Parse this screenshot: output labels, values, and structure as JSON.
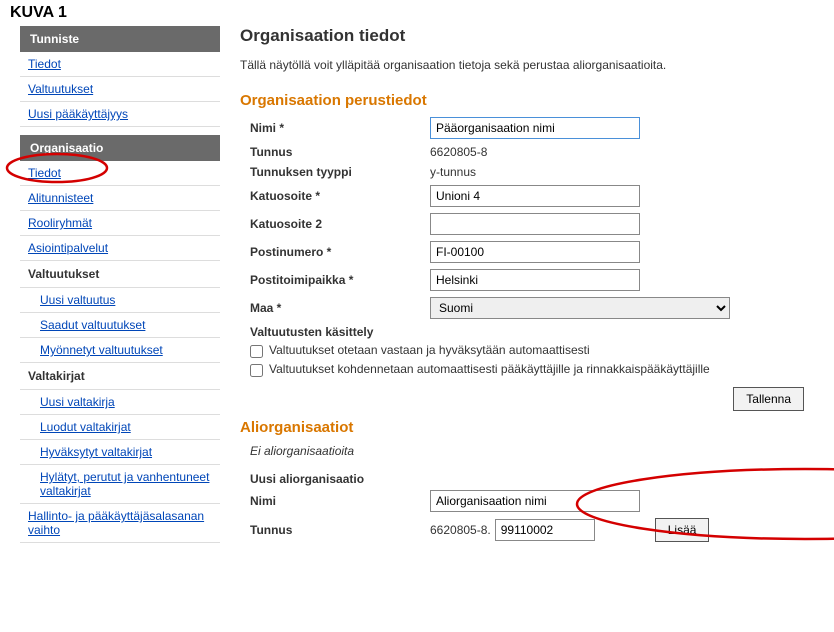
{
  "header_label": "KUVA 1",
  "sidebar": {
    "group1": {
      "title": "Tunniste",
      "items": [
        "Tiedot",
        "Valtuutukset",
        "Uusi pääkäyttäjyys"
      ]
    },
    "group2": {
      "title": "Organisaatio",
      "items": [
        "Tiedot",
        "Alitunnisteet",
        "Rooliryhmät",
        "Asiointipalvelut"
      ],
      "valtuutukset_label": "Valtuutukset",
      "valtuutukset_items": [
        "Uusi valtuutus",
        "Saadut valtuutukset",
        "Myönnetyt valtuutukset"
      ],
      "valtakirjat_label": "Valtakirjat",
      "valtakirjat_items": [
        "Uusi valtakirja",
        "Luodut valtakirjat",
        "Hyväksytyt valtakirjat",
        "Hylätyt, perutut ja vanhentuneet valtakirjat"
      ],
      "hallinto": "Hallinto- ja pääkäyttäjäsalasanan vaihto"
    }
  },
  "main": {
    "title": "Organisaation tiedot",
    "intro": "Tällä näytöllä voit ylläpitää organisaation tietoja sekä perustaa aliorganisaatioita.",
    "section_perustiedot": "Organisaation perustiedot",
    "labels": {
      "nimi": "Nimi *",
      "tunnus": "Tunnus",
      "tunnuksen_tyyppi": "Tunnuksen tyyppi",
      "katuosoite": "Katuosoite *",
      "katuosoite2": "Katuosoite 2",
      "postinumero": "Postinumero *",
      "postitoimipaikka": "Postitoimipaikka *",
      "maa": "Maa *",
      "valtuutusten": "Valtuutusten käsittely"
    },
    "values": {
      "nimi": "Pääorganisaation nimi",
      "tunnus": "6620805-8",
      "tunnuksen_tyyppi": "y-tunnus",
      "katuosoite": "Unioni 4",
      "katuosoite2": "",
      "postinumero": "FI-00100",
      "postitoimipaikka": "Helsinki",
      "maa": "Suomi"
    },
    "checkbox1": "Valtuutukset otetaan vastaan ja hyväksytään automaattisesti",
    "checkbox2": "Valtuutukset kohdennetaan automaattisesti pääkäyttäjille ja rinnakkaispääkäyttäjille",
    "tallenna": "Tallenna",
    "section_aliorg": "Aliorganisaatiot",
    "no_aliorg": "Ei aliorganisaatioita",
    "uusi_aliorg": "Uusi aliorganisaatio",
    "ali_nimi_label": "Nimi",
    "ali_nimi_value": "Aliorganisaation nimi",
    "ali_tunnus_label": "Tunnus",
    "ali_tunnus_prefix": "6620805-8.",
    "ali_tunnus_value": "99110002",
    "lisaa": "Lisää"
  }
}
